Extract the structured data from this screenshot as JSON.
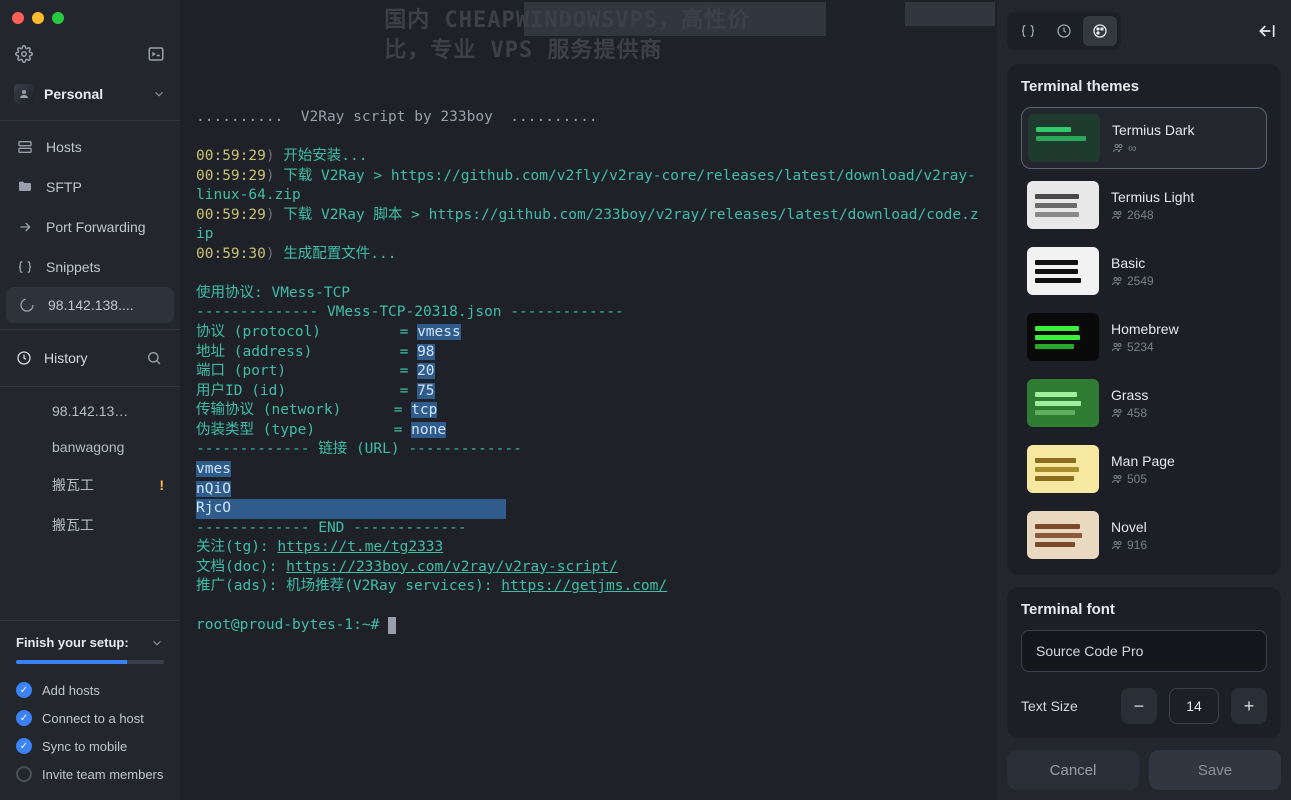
{
  "window": {
    "title_watermark": "国内 CHEAPWINDOWSVPS，高性价比，专业 VPS 服务提供商"
  },
  "profile": {
    "name": "Personal"
  },
  "nav": {
    "hosts": "Hosts",
    "sftp": "SFTP",
    "port_forwarding": "Port Forwarding",
    "snippets": "Snippets"
  },
  "active_host": "98.142.138....",
  "history": {
    "label": "History",
    "items": [
      "98.142.13…",
      "banwagong",
      "搬瓦工",
      "搬瓦工"
    ]
  },
  "setup": {
    "title": "Finish your setup:",
    "items": [
      {
        "label": "Add hosts",
        "done": true
      },
      {
        "label": "Connect to a host",
        "done": true
      },
      {
        "label": "Sync to mobile",
        "done": true
      },
      {
        "label": "Invite team members",
        "done": false
      }
    ]
  },
  "terminal": {
    "line_intro": "..........  V2Ray script by 233boy  ..........",
    "l1_ts": "00:59:29",
    "l1_txt": "开始安装...",
    "l2_ts": "00:59:29",
    "l2_txt": "下载 V2Ray > https://github.com/v2fly/v2ray-core/releases/latest/download/v2ray-linux-64.zip",
    "l3_ts": "00:59:29",
    "l3_txt": "下载 V2Ray 脚本 > https://github.com/233boy/v2ray/releases/latest/download/code.zip",
    "l4_ts": "00:59:30",
    "l4_txt": "生成配置文件...",
    "l5": "使用协议: ",
    "l5v": "VMess-TCP",
    "l6": "-------------- VMess-TCP-20318.json -------------",
    "l7k": "协议 (protocol)",
    "l7v": "vmess",
    "l8k": "地址 (address)",
    "l8v": "98",
    "l9k": "端口 (port)",
    "l9v": "20",
    "l10k": "用户ID (id)",
    "l10v": "75",
    "l11k": "传输协议 (network)",
    "l11v": "tcp",
    "l12k": "伪装类型 (type)",
    "l12v": "none",
    "l13": "------------- 链接 (URL) -------------",
    "l14": "vmes",
    "l15": "nQiO",
    "l16": "RjcO",
    "l17": "------------- END -------------",
    "l18k": "关注(tg): ",
    "l18v": "https://t.me/tg2333",
    "l19k": "文档(doc): ",
    "l19v": "https://233boy.com/v2ray/v2ray-script/",
    "l20k": "推广(ads): 机场推荐(V2Ray services): ",
    "l20v": "https://getjms.com/",
    "prompt": "root@proud-bytes-1:~# "
  },
  "themes": {
    "heading": "Terminal themes",
    "list": [
      {
        "name": "Termius Dark",
        "count": "∞",
        "selected": true
      },
      {
        "name": "Termius Light",
        "count": "2648"
      },
      {
        "name": "Basic",
        "count": "2549"
      },
      {
        "name": "Homebrew",
        "count": "5234"
      },
      {
        "name": "Grass",
        "count": "458"
      },
      {
        "name": "Man Page",
        "count": "505"
      },
      {
        "name": "Novel",
        "count": "916"
      }
    ]
  },
  "font": {
    "heading": "Terminal font",
    "value": "Source Code Pro",
    "size_label": "Text Size",
    "size": "14"
  },
  "buttons": {
    "cancel": "Cancel",
    "save": "Save"
  },
  "thumb_colors": {
    "0": {
      "bg": "#1f3a2e",
      "bars": [
        "#32c96b",
        "#2aa857",
        "#1f3a2e"
      ]
    },
    "1": {
      "bg": "#e8e8e8",
      "bars": [
        "#4a4a4a",
        "#6a6a6a",
        "#8a8a8a"
      ]
    },
    "2": {
      "bg": "#f2f2f2",
      "bars": [
        "#111",
        "#111",
        "#111"
      ]
    },
    "3": {
      "bg": "#0a0a0a",
      "bars": [
        "#3bf03b",
        "#3bf03b",
        "#2aa82a"
      ]
    },
    "4": {
      "bg": "#2e7d32",
      "bars": [
        "#9ef09e",
        "#9ef09e",
        "#5caf5c"
      ]
    },
    "5": {
      "bg": "#f6e8a0",
      "bars": [
        "#8a6d1c",
        "#a88d2c",
        "#8a6d1c"
      ]
    },
    "6": {
      "bg": "#e8d9c0",
      "bars": [
        "#7a4a2a",
        "#8a5a3a",
        "#7a4a2a"
      ]
    }
  }
}
